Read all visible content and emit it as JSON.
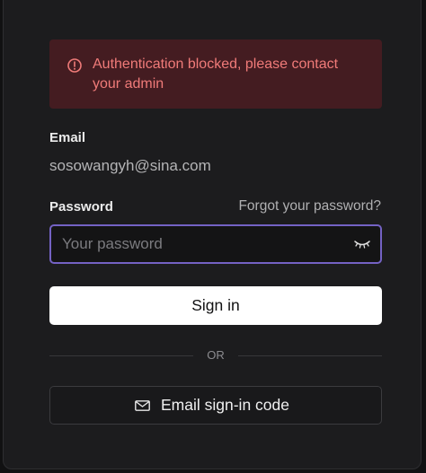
{
  "alert": {
    "icon": "alert-circle-icon",
    "message": "Authentication blocked, please contact your admin",
    "color": "#f07b79",
    "background": "#441c21"
  },
  "email": {
    "label": "Email",
    "value": "sosowangyh@sina.com"
  },
  "password": {
    "label": "Password",
    "forgot_link": "Forgot your password?",
    "placeholder": "Your password",
    "value": "",
    "toggle_icon": "eye-closed-icon",
    "focus_color": "#7462c4"
  },
  "actions": {
    "sign_in": "Sign in",
    "divider": "OR",
    "email_code": "Email sign-in code",
    "email_code_icon": "mail-icon"
  }
}
